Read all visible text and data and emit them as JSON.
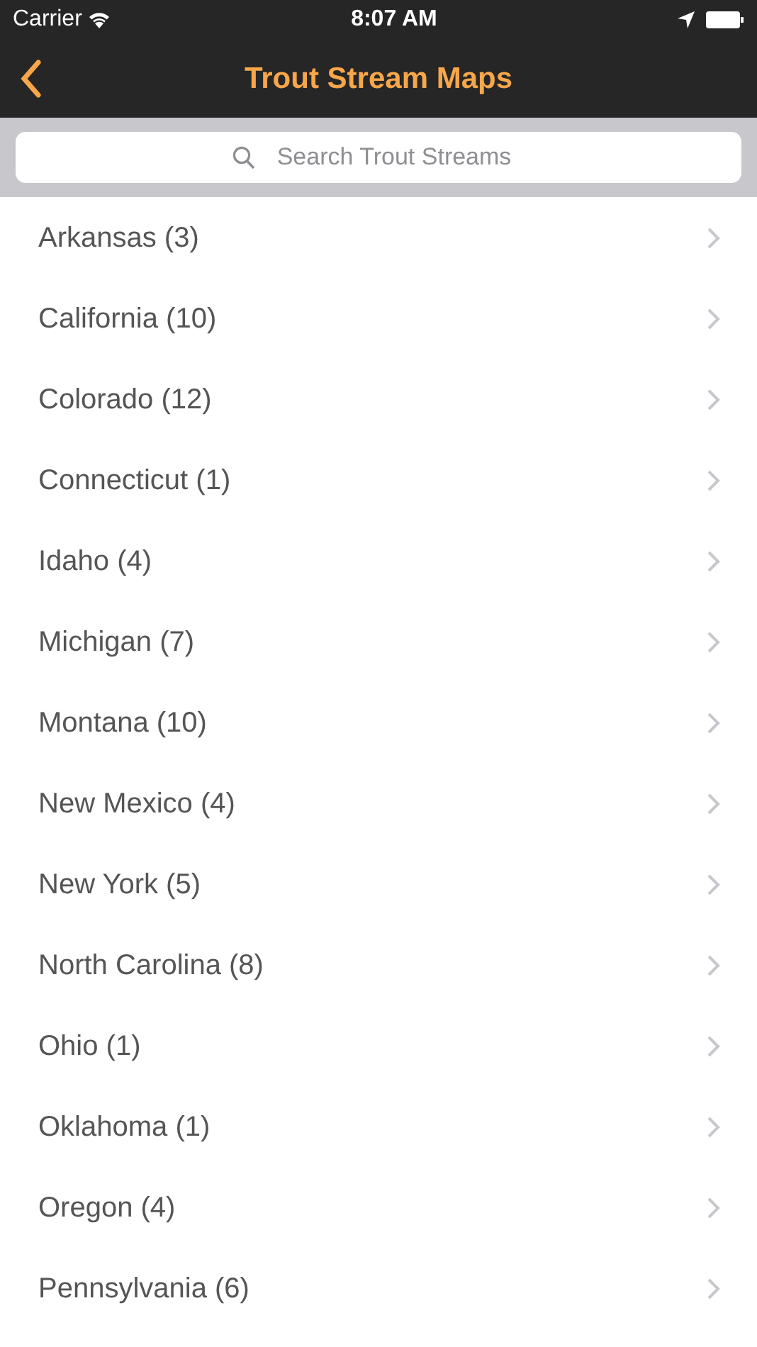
{
  "status_bar": {
    "carrier": "Carrier",
    "time": "8:07 AM"
  },
  "nav_bar": {
    "title": "Trout Stream Maps"
  },
  "search": {
    "placeholder": "Search Trout Streams"
  },
  "items": [
    {
      "label": "Arkansas (3)"
    },
    {
      "label": "California (10)"
    },
    {
      "label": "Colorado (12)"
    },
    {
      "label": "Connecticut (1)"
    },
    {
      "label": "Idaho (4)"
    },
    {
      "label": "Michigan (7)"
    },
    {
      "label": "Montana (10)"
    },
    {
      "label": "New Mexico (4)"
    },
    {
      "label": "New York (5)"
    },
    {
      "label": "North Carolina (8)"
    },
    {
      "label": "Ohio (1)"
    },
    {
      "label": "Oklahoma (1)"
    },
    {
      "label": "Oregon (4)"
    },
    {
      "label": "Pennsylvania (6)"
    }
  ]
}
